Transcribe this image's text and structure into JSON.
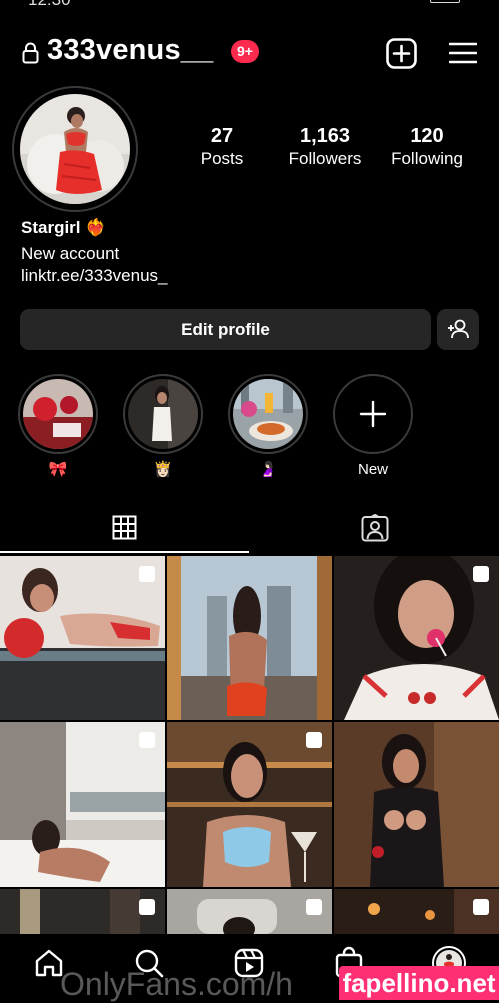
{
  "status_bar": {
    "time": "12:30"
  },
  "header": {
    "username": "333venus__",
    "notification_count": "9+",
    "icons": {
      "lock": "lock-icon",
      "create": "plus-square-icon",
      "menu": "hamburger-menu-icon"
    }
  },
  "stats": {
    "posts": {
      "value": "27",
      "label": "Posts"
    },
    "followers": {
      "value": "1,163",
      "label": "Followers"
    },
    "following": {
      "value": "120",
      "label": "Following"
    }
  },
  "bio": {
    "name": "Stargirl ❤️‍🔥",
    "line": "New account",
    "link": "linktr.ee/333venus_"
  },
  "actions": {
    "edit_profile": "Edit profile",
    "add_person_icon": "add-person-icon"
  },
  "highlights": [
    {
      "label": "🎀"
    },
    {
      "label": "👸🏻"
    },
    {
      "label": "🤰🏻"
    },
    {
      "label": "New"
    }
  ],
  "tabs": [
    {
      "icon": "grid-icon",
      "active": true
    },
    {
      "icon": "tagged-icon",
      "active": false
    }
  ],
  "bottom_nav": [
    "home-icon",
    "search-icon",
    "reels-icon",
    "shop-icon",
    "profile-avatar"
  ],
  "watermarks": {
    "left": "OnlyFans.com/h",
    "right": "fapellino.net"
  },
  "colors": {
    "accent_badge": "#ff2b4e",
    "button_bg": "#262626",
    "watermark": "#ff2f73"
  }
}
